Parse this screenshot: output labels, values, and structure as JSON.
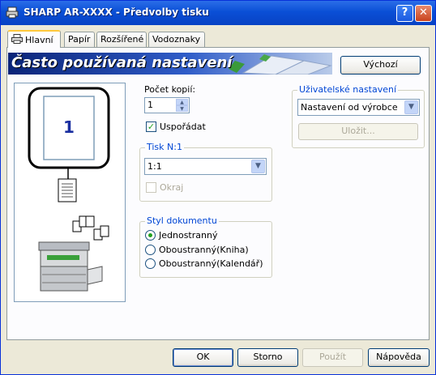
{
  "window": {
    "title": "SHARP AR-XXXX - Předvolby tisku",
    "help_label": "?",
    "close_label": "✕"
  },
  "tabs": [
    {
      "label": "Hlavní",
      "active": true
    },
    {
      "label": "Papír",
      "active": false
    },
    {
      "label": "Rozšířené",
      "active": false
    },
    {
      "label": "Vodoznaky",
      "active": false
    }
  ],
  "banner": {
    "title": "Často používaná nastavení"
  },
  "buttons": {
    "default_label": "Výchozí",
    "save_label": "Uložit...",
    "ok_label": "OK",
    "cancel_label": "Storno",
    "apply_label": "Použít",
    "help_label": "Nápověda"
  },
  "preview": {
    "page_number": "1"
  },
  "copies": {
    "label": "Počet kopií:",
    "value": "1"
  },
  "collate": {
    "label": "Uspořádat",
    "checked": true
  },
  "nup": {
    "group_title": "Tisk N:1",
    "selected": "1:1",
    "border_label": "Okraj",
    "border_checked": false
  },
  "doc_style": {
    "group_title": "Styl dokumentu",
    "options": [
      {
        "label": "Jednostranný",
        "selected": true
      },
      {
        "label": "Oboustranný(Kniha)",
        "selected": false
      },
      {
        "label": "Oboustranný(Kalendář)",
        "selected": false
      }
    ]
  },
  "user_settings": {
    "group_title": "Uživatelské nastavení",
    "selected": "Nastavení od výrobce"
  },
  "icons": {
    "title": "printer-icon",
    "tab": "printer-small-icon"
  }
}
